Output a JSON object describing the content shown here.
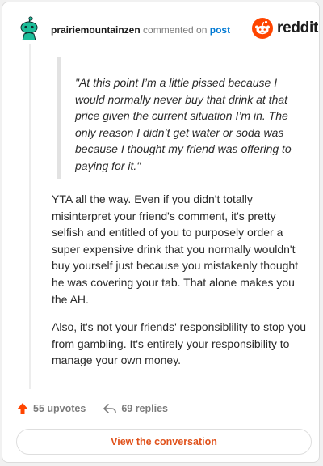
{
  "header": {
    "username": "prairiemountainzen",
    "action_text": "commented on",
    "post_link": "post",
    "brand": "reddit"
  },
  "comment": {
    "quote": "\"At this point I’m a little pissed because I would normally never buy that drink at that price given the current situation I’m in. The only reason I didn’t get water or soda was because I thought my friend was offering to paying for it.\"",
    "paragraphs": [
      "YTA all the way. Even if you didn't totally misinterpret your friend's comment, it's pretty selfish and entitled of you to purposely order a super expensive drink that you normally wouldn't buy yourself just because you mistakenly thought he was covering your tab. That alone makes you the AH.",
      "Also, it's not your friends' responsiblility to stop you from gambling. It's entirely your responsibility to manage your own money."
    ]
  },
  "stats": {
    "upvotes": "55 upvotes",
    "replies": "69 replies"
  },
  "actions": {
    "view_label": "View the conversation"
  },
  "icons": {
    "avatar": "snoo-avatar-icon",
    "brand": "reddit-logo-icon",
    "upvote": "upvote-arrow-icon",
    "reply": "reply-arrow-icon"
  },
  "colors": {
    "avatar": "#1dbd99",
    "brand_orange": "#ff4500",
    "upvote": "#ff4500",
    "link": "#0079d3",
    "button_text": "#e0531d"
  }
}
